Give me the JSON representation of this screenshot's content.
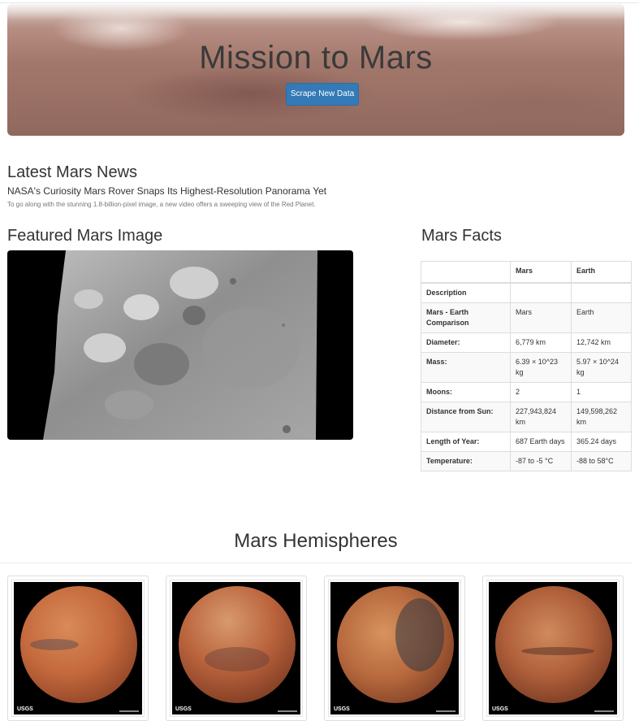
{
  "header": {
    "title": "Mission to Mars",
    "scrape_button": "Scrape New Data"
  },
  "news": {
    "section_title": "Latest Mars News",
    "headline": "NASA's Curiosity Mars Rover Snaps Its Highest-Resolution Panorama Yet",
    "teaser": "To go along with the stunning 1.8-billion-pixel image, a new video offers a sweeping view of the Red Planet."
  },
  "featured": {
    "section_title": "Featured Mars Image"
  },
  "facts": {
    "section_title": "Mars Facts",
    "columns": [
      "",
      "Mars",
      "Earth"
    ],
    "rows": [
      [
        "Description",
        "",
        ""
      ],
      [
        "Mars - Earth Comparison",
        "Mars",
        "Earth"
      ],
      [
        "Diameter:",
        "6,779 km",
        "12,742 km"
      ],
      [
        "Mass:",
        "6.39 × 10^23 kg",
        "5.97 × 10^24 kg"
      ],
      [
        "Moons:",
        "2",
        "1"
      ],
      [
        "Distance from Sun:",
        "227,943,824 km",
        "149,598,262 km"
      ],
      [
        "Length of Year:",
        "687 Earth days",
        "365.24 days"
      ],
      [
        "Temperature:",
        "-87 to -5 °C",
        "-88 to 58°C"
      ]
    ]
  },
  "hemispheres": {
    "section_title": "Mars Hemispheres",
    "thumb_logo": "USGS",
    "planet_colors": [
      "#c4693d",
      "#b9623c",
      "#b86a3e",
      "#b0603b"
    ]
  }
}
